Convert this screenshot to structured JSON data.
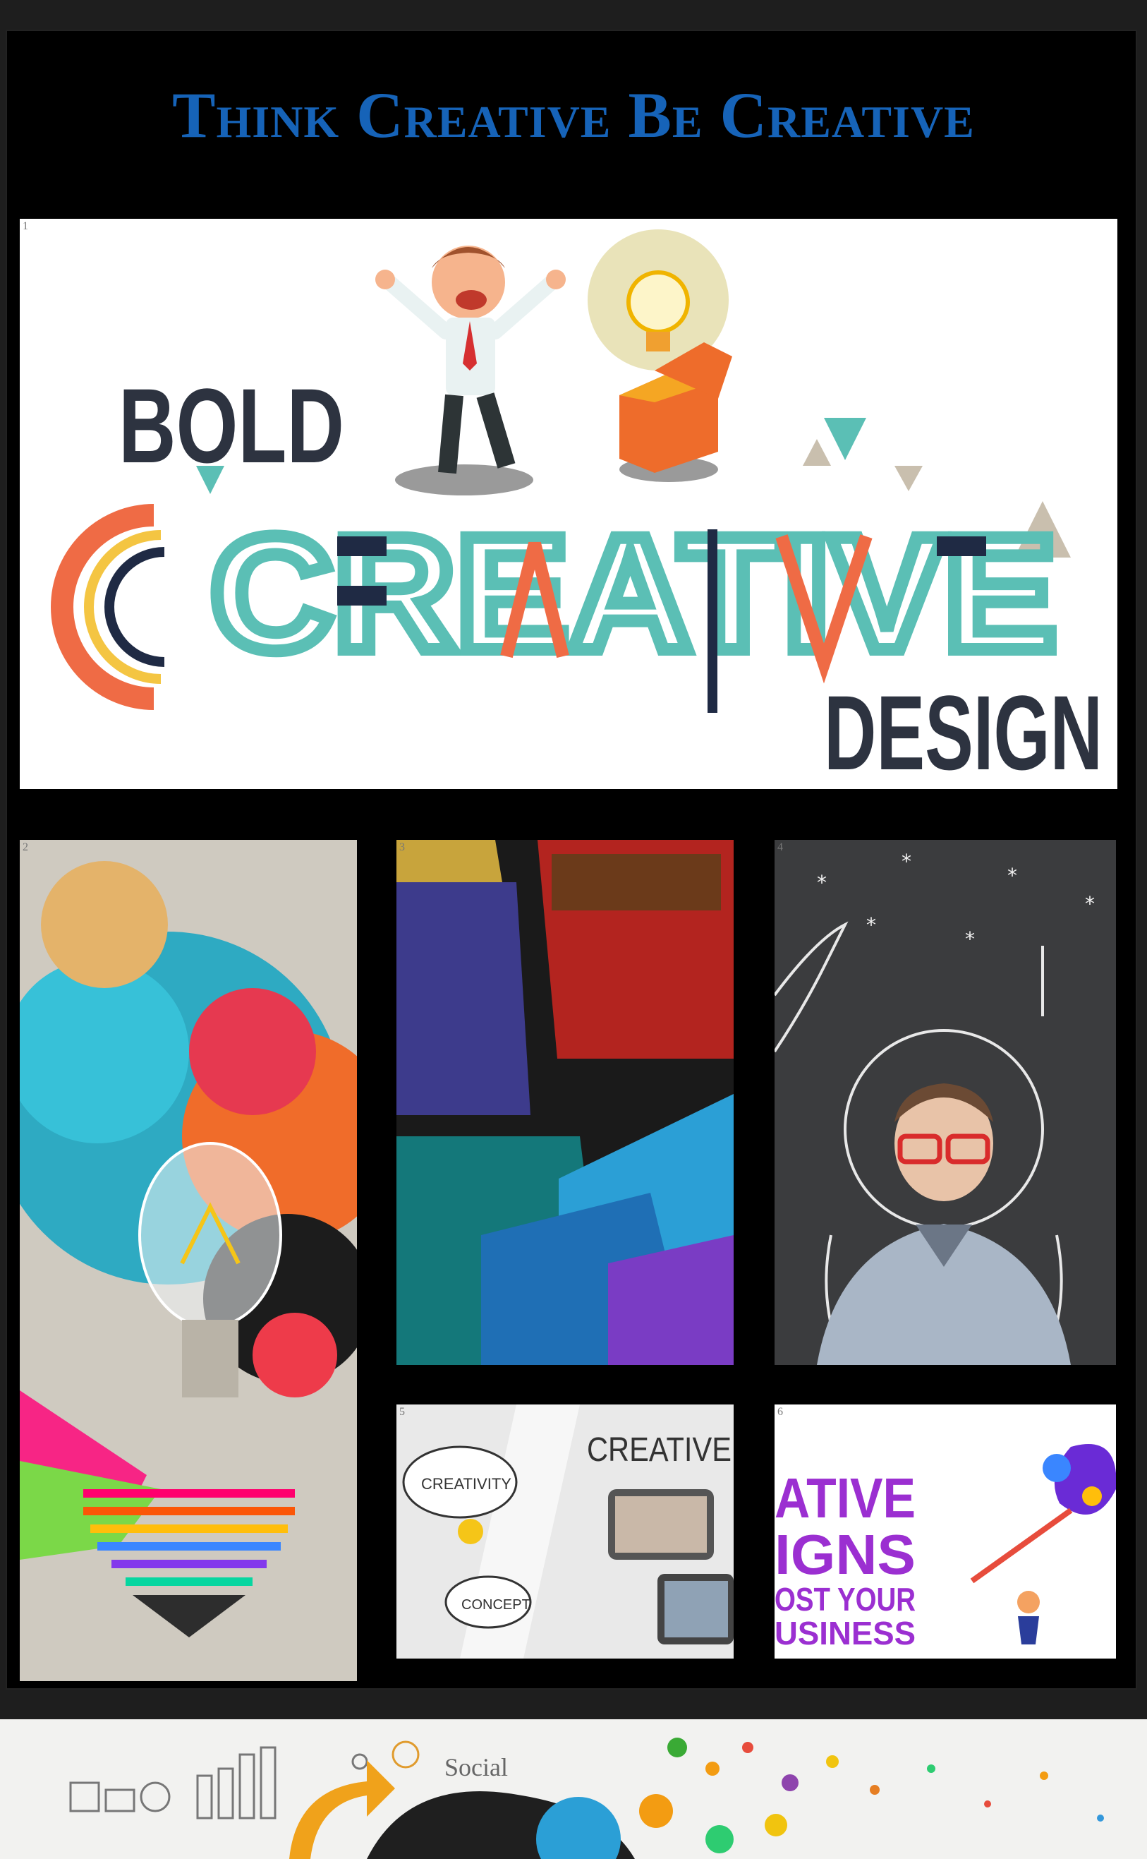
{
  "title": "Think Creative Be Creative",
  "tiles": [
    {
      "number": "1",
      "banner": {
        "bold": "BOLD",
        "creative": "CREATIVE",
        "design": "DESIGN"
      }
    },
    {
      "number": "2"
    },
    {
      "number": "3"
    },
    {
      "number": "4"
    },
    {
      "number": "5",
      "heading": "CREATIVE",
      "cloud1": "CREATIVITY",
      "cloud2": "CONCEPT"
    },
    {
      "number": "6",
      "lines": [
        "ATIVE",
        "IGNS",
        "OST YOUR",
        "USINESS"
      ]
    }
  ],
  "footer_strip": {
    "label": "Social"
  },
  "colors": {
    "title_blue": "#1663b8",
    "teal": "#5bbfb5",
    "orange": "#ef6b45",
    "navy": "#1f2a44",
    "purple": "#8a2be2"
  }
}
